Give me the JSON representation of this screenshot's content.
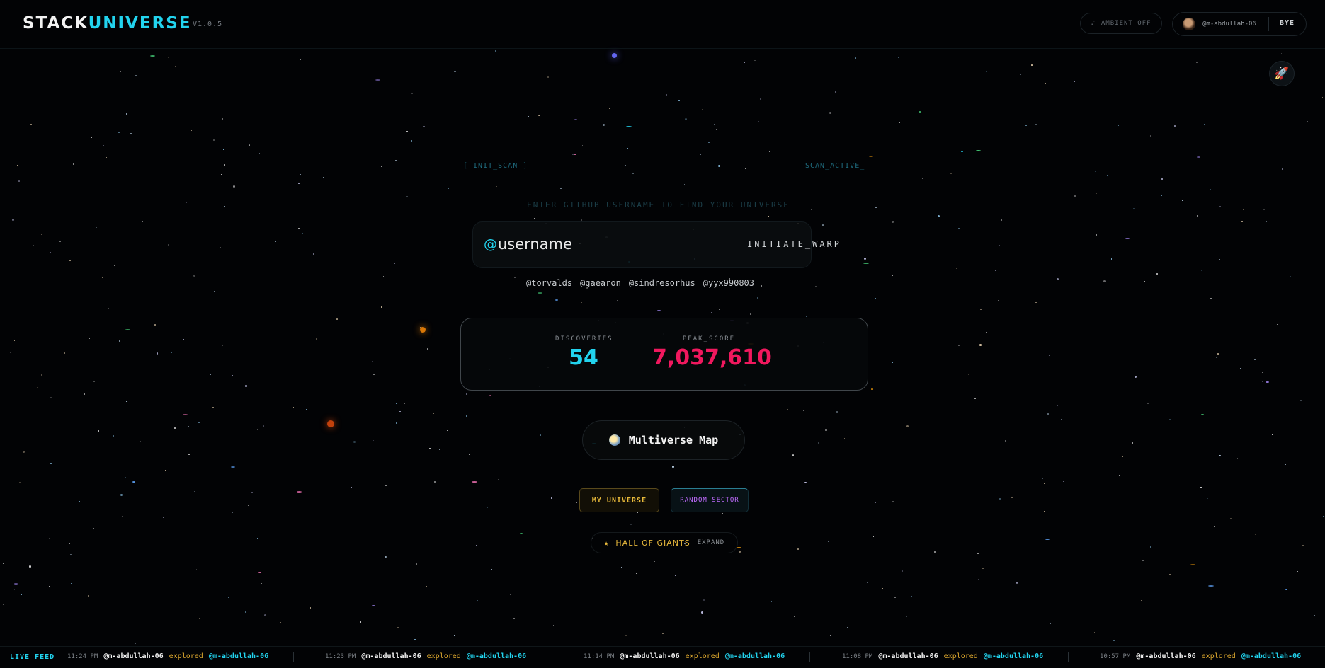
{
  "header": {
    "brand_part1": "STACK",
    "brand_part2": "UNIVERSE",
    "version": "V1.0.5",
    "ambient_icon": "♪",
    "ambient_label": "AMBIENT OFF",
    "user_handle": "@m-abdullah-06",
    "logout_label": "BYE"
  },
  "rocket_button": {
    "icon": "rocket-icon",
    "glyph": "🚀"
  },
  "scan": {
    "left_label": "[ INIT_SCAN ]",
    "right_label": "SCAN_ACTIVE_",
    "hint": "ENTER GITHUB USERNAME TO FIND YOUR UNIVERSE"
  },
  "search": {
    "at_symbol": "@",
    "placeholder": "username",
    "value": "",
    "submit_label": "INITIATE_WARP"
  },
  "suggestions": [
    "@torvalds",
    "@gaearon",
    "@sindresorhus",
    "@yyx990803"
  ],
  "stats": {
    "discoveries_label": "DISCOVERIES",
    "discoveries_value": "54",
    "peak_label": "PEAK_SCORE",
    "peak_value": "7,037,610"
  },
  "actions": {
    "multiverse_icon": "globe-icon",
    "multiverse_label": "Multiverse Map",
    "my_universe_label": "MY UNIVERSE",
    "random_sector_label": "RANDOM SECTOR",
    "hall_star": "★",
    "hall_label": "HALL OF GIANTS",
    "expand_label": "EXPAND"
  },
  "feed": {
    "label": "LIVE FEED",
    "items": [
      {
        "time": "11:24 PM",
        "user": "@m-abdullah-06",
        "verb": "explored",
        "target": "@m-abdullah-06"
      },
      {
        "time": "11:23 PM",
        "user": "@m-abdullah-06",
        "verb": "explored",
        "target": "@m-abdullah-06"
      },
      {
        "time": "11:14 PM",
        "user": "@m-abdullah-06",
        "verb": "explored",
        "target": "@m-abdullah-06"
      },
      {
        "time": "11:08 PM",
        "user": "@m-abdullah-06",
        "verb": "explored",
        "target": "@m-abdullah-06"
      },
      {
        "time": "10:57 PM",
        "user": "@m-abdullah-06",
        "verb": "explored",
        "target": "@m-abdullah-06"
      }
    ]
  },
  "colors": {
    "accent": "#22d3ee",
    "score": "#f0185e",
    "gold": "#e7b93a",
    "purple": "#c06bff",
    "background": "#020305"
  }
}
